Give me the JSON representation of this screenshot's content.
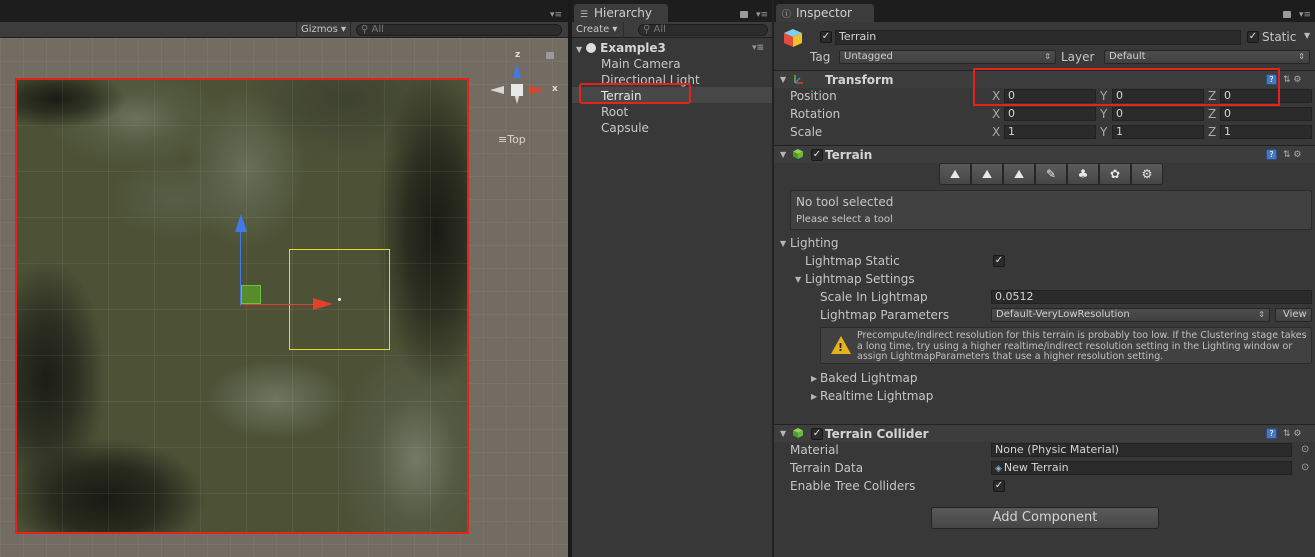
{
  "scene": {
    "toolbar": {
      "gizmos_label": "Gizmos ▾",
      "search_placeholder": "All"
    },
    "orientation": {
      "z_label": "z",
      "x_label": "x",
      "view_label": "Top"
    }
  },
  "hierarchy": {
    "tab_label": "Hierarchy",
    "create_label": "Create ▾",
    "search_placeholder": "All",
    "scene_name": "Example3",
    "items": [
      {
        "label": "Main Camera"
      },
      {
        "label": "Directional Light"
      },
      {
        "label": "Terrain"
      },
      {
        "label": "Root"
      },
      {
        "label": "Capsule"
      }
    ]
  },
  "inspector": {
    "tab_label": "Inspector",
    "object_name": "Terrain",
    "static_label": "Static",
    "tag_label": "Tag",
    "tag_value": "Untagged",
    "layer_label": "Layer",
    "layer_value": "Default",
    "transform": {
      "title": "Transform",
      "position_label": "Position",
      "rotation_label": "Rotation",
      "scale_label": "Scale",
      "axis_x": "X",
      "axis_y": "Y",
      "axis_z": "Z",
      "position": {
        "x": "0",
        "y": "0",
        "z": "0"
      },
      "rotation": {
        "x": "0",
        "y": "0",
        "z": "0"
      },
      "scale": {
        "x": "1",
        "y": "1",
        "z": "1"
      }
    },
    "terrain": {
      "title": "Terrain",
      "no_tool": "No tool selected",
      "select_tool": "Please select a tool",
      "lighting_label": "Lighting",
      "lightmap_static_label": "Lightmap Static",
      "lightmap_settings_label": "Lightmap Settings",
      "scale_in_lightmap_label": "Scale In Lightmap",
      "scale_in_lightmap_value": "0.0512",
      "lightmap_parameters_label": "Lightmap Parameters",
      "lightmap_parameters_value": "Default-VeryLowResolution",
      "view_button": "View",
      "warning": "Precompute/indirect resolution for this terrain is probably too low. If the Clustering stage takes a long time, try using a higher realtime/indirect resolution setting in the Lighting window or assign LightmapParameters that use a higher resolution setting.",
      "baked_lightmap_label": "Baked Lightmap",
      "realtime_lightmap_label": "Realtime Lightmap"
    },
    "terrain_collider": {
      "title": "Terrain Collider",
      "material_label": "Material",
      "material_value": "None (Physic Material)",
      "terrain_data_label": "Terrain Data",
      "terrain_data_value": "New Terrain",
      "tree_colliders_label": "Enable Tree Colliders"
    },
    "add_component": "Add Component"
  },
  "colors": {
    "highlight_red": "#e4231b",
    "selection_yellow": "#f1d526",
    "axis_y_blue": "#3f7be8",
    "axis_x_red": "#e0412a",
    "warning_yellow": "#e8b21f"
  }
}
